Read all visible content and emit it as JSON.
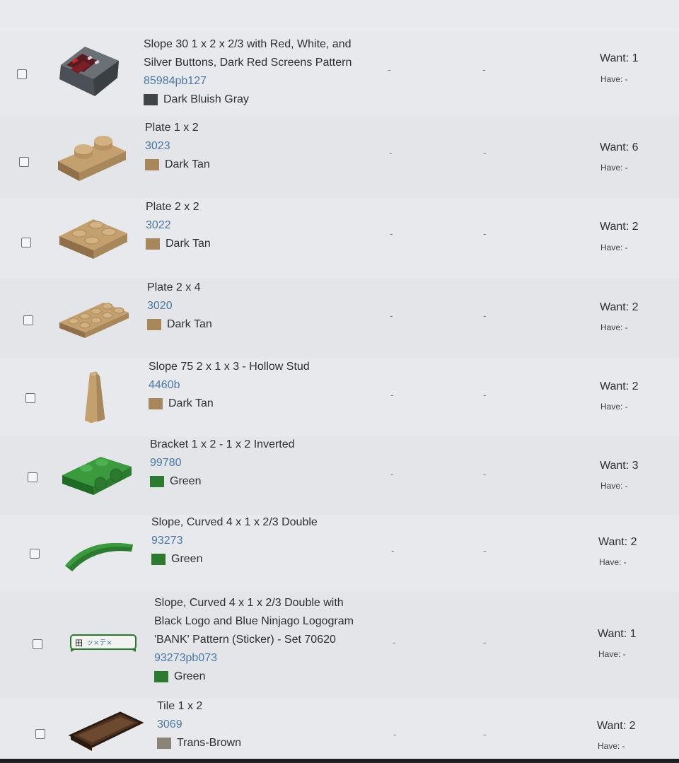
{
  "colors": {
    "dark_bluish_gray": "#3e4448",
    "dark_tan": "#a8875a",
    "green": "#2b7a2f",
    "trans_brown": "#8a8378",
    "link": "#4a78a8"
  },
  "items": [
    {
      "name_lines": [
        "Slope 30 1 x 2 x 2/3 with Red, White, and",
        "Silver Buttons, Dark Red Screens Pattern"
      ],
      "part": "85984pb127",
      "color": "Dark Bluish Gray",
      "swatch": "#3e4448",
      "dash1": "-",
      "dash2": "-",
      "want": "Want: 1",
      "have": "Have: -"
    },
    {
      "name_lines": [
        "Plate 1 x 2"
      ],
      "part": "3023",
      "color": "Dark Tan",
      "swatch": "#a8875a",
      "dash1": "-",
      "dash2": "-",
      "want": "Want: 6",
      "have": "Have: -"
    },
    {
      "name_lines": [
        "Plate 2 x 2"
      ],
      "part": "3022",
      "color": "Dark Tan",
      "swatch": "#a8875a",
      "dash1": "-",
      "dash2": "-",
      "want": "Want: 2",
      "have": "Have: -"
    },
    {
      "name_lines": [
        "Plate 2 x 4"
      ],
      "part": "3020",
      "color": "Dark Tan",
      "swatch": "#a8875a",
      "dash1": "-",
      "dash2": "-",
      "want": "Want: 2",
      "have": "Have: -"
    },
    {
      "name_lines": [
        "Slope 75 2 x 1 x 3 - Hollow Stud"
      ],
      "part": "4460b",
      "color": "Dark Tan",
      "swatch": "#a8875a",
      "dash1": "-",
      "dash2": "-",
      "want": "Want: 2",
      "have": "Have: -"
    },
    {
      "name_lines": [
        "Bracket 1 x 2 - 1 x 2 Inverted"
      ],
      "part": "99780",
      "color": "Green",
      "swatch": "#2b7a2f",
      "dash1": "-",
      "dash2": "-",
      "want": "Want: 3",
      "have": "Have: -"
    },
    {
      "name_lines": [
        "Slope, Curved 4 x 1 x 2/3 Double"
      ],
      "part": "93273",
      "color": "Green",
      "swatch": "#2b7a2f",
      "dash1": "-",
      "dash2": "-",
      "want": "Want: 2",
      "have": "Have: -"
    },
    {
      "name_lines": [
        "Slope, Curved 4 x 1 x 2/3 Double with",
        "Black Logo and Blue Ninjago Logogram",
        "'BANK' Pattern (Sticker) - Set 70620"
      ],
      "part": "93273pb073",
      "color": "Green",
      "swatch": "#2b7a2f",
      "dash1": "-",
      "dash2": "-",
      "want": "Want: 1",
      "have": "Have: -"
    },
    {
      "name_lines": [
        "Tile 1 x 2"
      ],
      "part": "3069",
      "color": "Trans-Brown",
      "swatch": "#8a8378",
      "dash1": "-",
      "dash2": "-",
      "want": "Want: 2",
      "have": "Have: -"
    }
  ]
}
